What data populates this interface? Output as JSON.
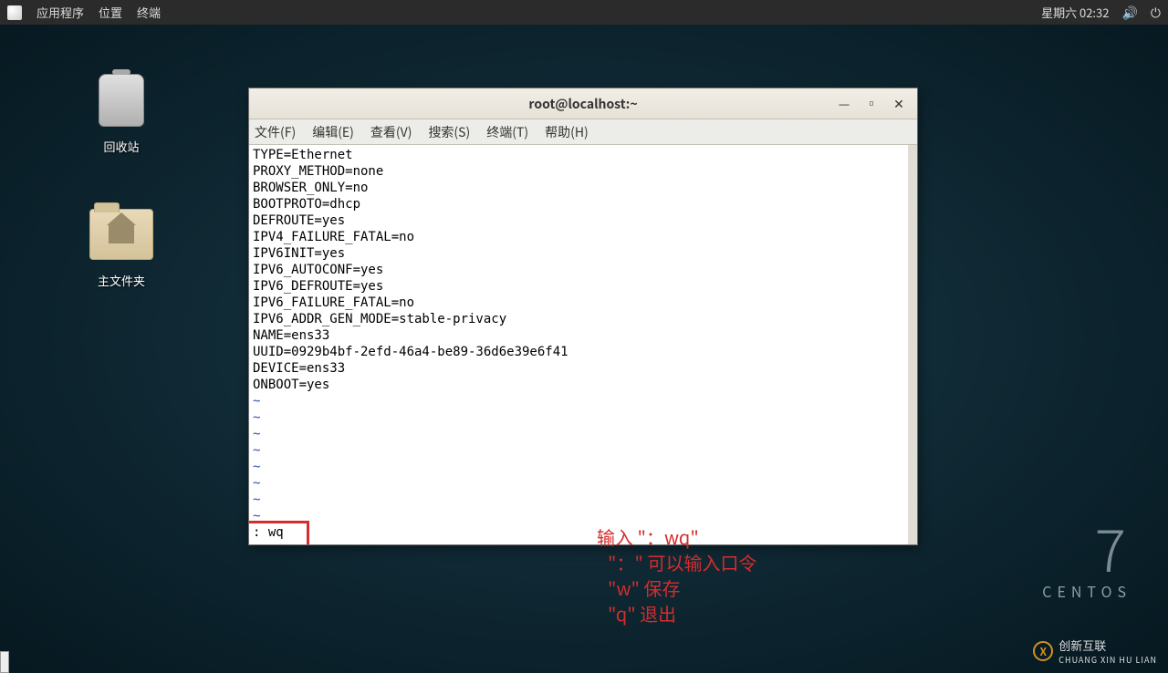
{
  "topbar": {
    "apps": "应用程序",
    "places": "位置",
    "terminal": "终端",
    "datetime": "星期六 02:32"
  },
  "desktop": {
    "trash": "回收站",
    "home": "主文件夹"
  },
  "centos": {
    "seven": "7",
    "name": "CENTOS"
  },
  "watermark": {
    "main": "创新互联",
    "sub": "CHUANG XIN HU LIAN",
    "logo": "X"
  },
  "terminal": {
    "title": "root@localhost:~",
    "menus": {
      "file": "文件(F)",
      "edit": "编辑(E)",
      "view": "查看(V)",
      "search": "搜索(S)",
      "term": "终端(T)",
      "help": "帮助(H)"
    },
    "lines": [
      "TYPE=Ethernet",
      "PROXY_METHOD=none",
      "BROWSER_ONLY=no",
      "BOOTPROTO=dhcp",
      "DEFROUTE=yes",
      "IPV4_FAILURE_FATAL=no",
      "IPV6INIT=yes",
      "IPV6_AUTOCONF=yes",
      "IPV6_DEFROUTE=yes",
      "IPV6_FAILURE_FATAL=no",
      "IPV6_ADDR_GEN_MODE=stable-privacy",
      "NAME=ens33",
      "UUID=0929b4bf-2efd-46a4-be89-36d6e39e6f41",
      "DEVICE=ens33",
      "ONBOOT=yes"
    ],
    "tilde": "~",
    "command": ": wq"
  },
  "annotations": {
    "a1": "输入 \"：wq\"",
    "a2": "\"：\" 可以输入口令",
    "a3": "\"w\" 保存",
    "a4": "\"q\" 退出"
  }
}
